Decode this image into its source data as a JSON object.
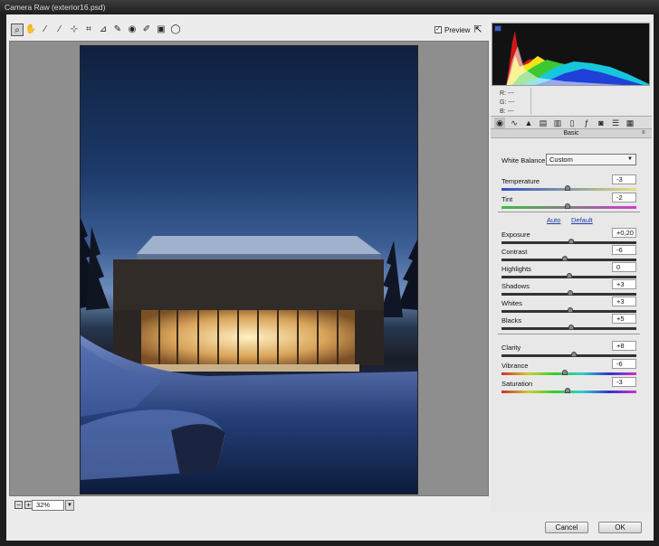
{
  "window": {
    "title": "Camera Raw (exterior16.psd)"
  },
  "toolbar": {
    "tools": [
      {
        "name": "zoom-tool-icon",
        "glyph": "⌕"
      },
      {
        "name": "hand-tool-icon",
        "glyph": "✋"
      },
      {
        "name": "white-balance-tool-icon",
        "glyph": "⁄"
      },
      {
        "name": "color-sampler-tool-icon",
        "glyph": "⁄"
      },
      {
        "name": "targeted-adjustment-tool-icon",
        "glyph": "⊹"
      },
      {
        "name": "crop-tool-icon",
        "glyph": "⌗"
      },
      {
        "name": "straighten-tool-icon",
        "glyph": "⊿"
      },
      {
        "name": "spot-removal-tool-icon",
        "glyph": "✎"
      },
      {
        "name": "red-eye-removal-tool-icon",
        "glyph": "◉"
      },
      {
        "name": "adjustment-brush-icon",
        "glyph": "✐"
      },
      {
        "name": "graduated-filter-icon",
        "glyph": "▣"
      },
      {
        "name": "radial-filter-icon",
        "glyph": "◯"
      }
    ],
    "preview_label": "Preview",
    "preview_checked": "✓"
  },
  "zoom": {
    "value": "32%",
    "minus": "−",
    "plus": "+"
  },
  "histogram": {
    "r_label": "R:",
    "g_label": "G:",
    "b_label": "B:",
    "r_value": "---",
    "g_value": "---",
    "b_value": "---"
  },
  "panel": {
    "title": "Basic",
    "tabs": [
      "basic-tab-icon",
      "tone-curve-tab-icon",
      "detail-tab-icon",
      "hsl-tab-icon",
      "split-toning-tab-icon",
      "lens-corrections-tab-icon",
      "effects-tab-icon",
      "camera-calibration-tab-icon",
      "presets-tab-icon",
      "snapshots-tab-icon"
    ],
    "white_balance_label": "White Balance:",
    "white_balance_value": "Custom",
    "auto_label": "Auto",
    "default_label": "Default",
    "sliders": [
      {
        "label": "Temperature",
        "value": "-3",
        "pos": 0.49,
        "track": "temp"
      },
      {
        "label": "Tint",
        "value": "-2",
        "pos": 0.49,
        "track": "tint"
      },
      {
        "label": "Exposure",
        "value": "+0,20",
        "pos": 0.52,
        "track": "gray"
      },
      {
        "label": "Contrast",
        "value": "-6",
        "pos": 0.47,
        "track": "gray"
      },
      {
        "label": "Highlights",
        "value": "0",
        "pos": 0.5,
        "track": "gray"
      },
      {
        "label": "Shadows",
        "value": "+3",
        "pos": 0.51,
        "track": "gray"
      },
      {
        "label": "Whites",
        "value": "+3",
        "pos": 0.51,
        "track": "gray"
      },
      {
        "label": "Blacks",
        "value": "+5",
        "pos": 0.52,
        "track": "gray"
      },
      {
        "label": "Clarity",
        "value": "+8",
        "pos": 0.54,
        "track": "gray"
      },
      {
        "label": "Vibrance",
        "value": "-6",
        "pos": 0.47,
        "track": "rainbow"
      },
      {
        "label": "Saturation",
        "value": "-3",
        "pos": 0.49,
        "track": "rainbow"
      }
    ]
  },
  "footer": {
    "cancel_label": "Cancel",
    "ok_label": "OK"
  }
}
